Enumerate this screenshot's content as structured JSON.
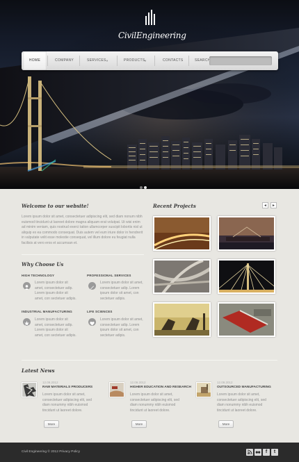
{
  "brand": {
    "logo_text": "CivilEngineering"
  },
  "nav": {
    "items": [
      {
        "label": "HOME"
      },
      {
        "label": "COMPANY"
      },
      {
        "label": "SERVICES"
      },
      {
        "label": "PRODUCTS"
      },
      {
        "label": "CONTACTS"
      },
      {
        "label": "SEARCH"
      }
    ],
    "search_value": ""
  },
  "slider": {
    "active_slide": 1,
    "slide_count": 2
  },
  "welcome": {
    "title": "Welcome to our website!",
    "text": "Lorem ipsum dolor sit amet, consectetuer adipiscing elit, sed diam nonum nibh euismod tincidunt ut laoreet dolore magna aliquam erat volutpat. Ut wisi enim ad minim veniam, quis nostrud exerci tation ullamcorper suscipit lobortis nisl ut aliquip ex ea commodo consequat. Duis autem vel eum iriure dolor in hendrerit in vulputate velit esse molestie consequat, vel illum dolore eu feugiat nulla facilisis at vero eros et accumsan et."
  },
  "why": {
    "title": "Why Choose Us",
    "items": [
      {
        "title": "HIGH TECHNOLOGY",
        "text": "Lorem ipsum dolor sit amet, consectetuer adip. Lorem ipsum dolor sit amet, con sectetuer adipis."
      },
      {
        "title": "PROFESSIONAL SERVICES",
        "text": "Lorem ipsum dolor sit amet, consectetuer adip. Lorem ipsum dolor sit amet, con sectetuer adipis."
      },
      {
        "title": "INDUSTRIAL MANUFACTURING",
        "text": "Lorem ipsum dolor sit amet, consectetuer adip. Lorem ipsum dolor sit amet, con sectetuer adipis."
      },
      {
        "title": "LIFE SCIENCES",
        "text": "Lorem ipsum dolor sit amet, consectetuer adip. Lorem ipsum dolor sit amet, con sectetuer adipis."
      }
    ]
  },
  "projects": {
    "title": "Recent Projects",
    "prev": "◄",
    "next": "►"
  },
  "news": {
    "title": "Latest News",
    "items": [
      {
        "date": "12.09.2012",
        "title": "RAW MATERIALS PRODUCERS",
        "text": "Lorem ipsum dolor sit amet, consectetuer adipiscing elit, sed diam nonummy nibh euismod tincidunt ut laoreet dolore.",
        "more": "More"
      },
      {
        "date": "12.09.2012",
        "title": "HIGHER EDUCATION AND RESEARCH",
        "text": "Lorem ipsum dolor sit amet, consectetuer adipiscing elit, sed diam nonummy nibh euismod tincidunt ut laoreet dolore.",
        "more": "More"
      },
      {
        "date": "12.09.2012",
        "title": "OUTSOURCED MANUFACTURING",
        "text": "Lorem ipsum dolor sit amet, consectetuer adipiscing elit, sed diam nonummy nibh euismod tincidunt ut laoreet dolore.",
        "more": "More"
      }
    ]
  },
  "footer": {
    "copyright": "Civil Engineering © 2012 Privacy Policy",
    "social": [
      "rss-icon",
      "flickr-icon",
      "facebook-icon",
      "twitter-icon"
    ],
    "facebook_glyph": "f",
    "twitter_glyph": "t"
  }
}
